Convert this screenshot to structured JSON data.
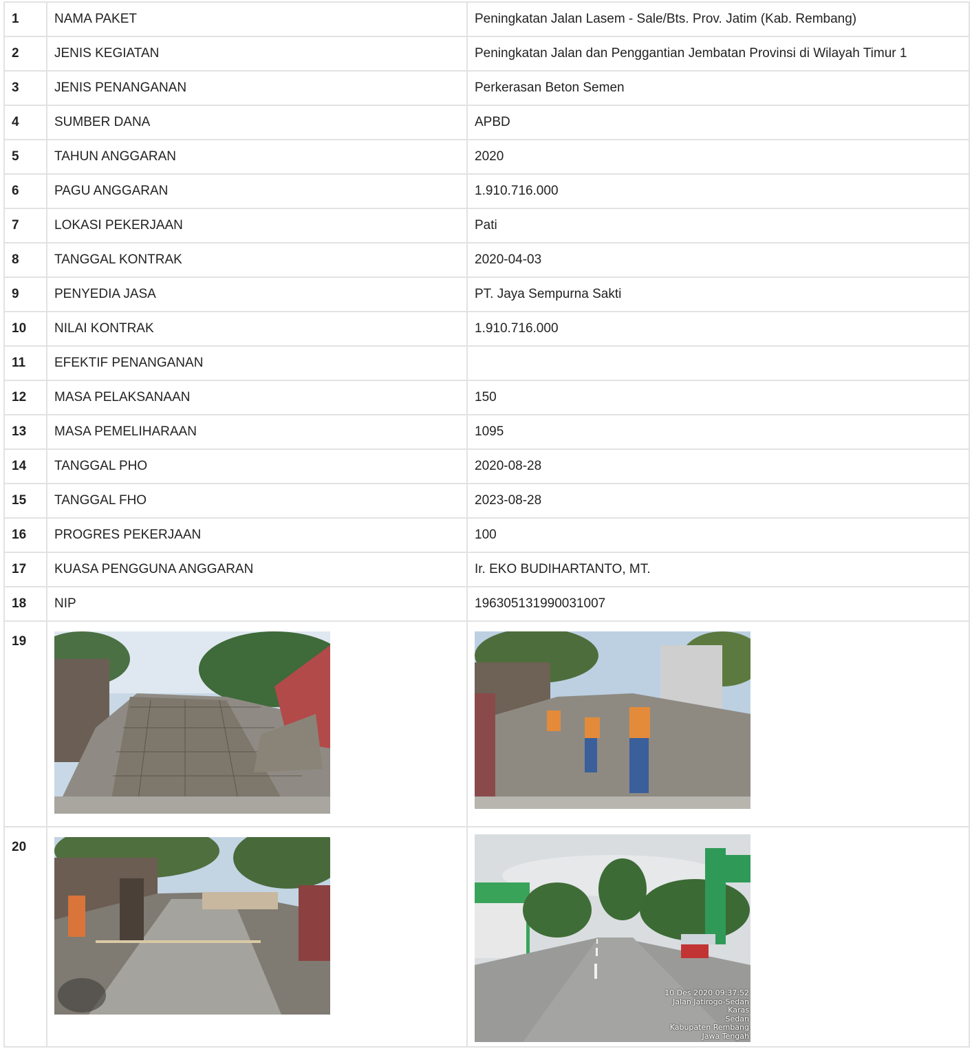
{
  "rows": [
    {
      "no": "1",
      "label": "NAMA PAKET",
      "value": "Peningkatan Jalan Lasem - Sale/Bts. Prov. Jatim (Kab. Rembang)"
    },
    {
      "no": "2",
      "label": "JENIS KEGIATAN",
      "value": "Peningkatan Jalan dan Penggantian Jembatan Provinsi di Wilayah Timur 1"
    },
    {
      "no": "3",
      "label": "JENIS PENANGANAN",
      "value": "Perkerasan Beton Semen"
    },
    {
      "no": "4",
      "label": "SUMBER DANA",
      "value": "APBD"
    },
    {
      "no": "5",
      "label": "TAHUN ANGGARAN",
      "value": "2020"
    },
    {
      "no": "6",
      "label": "PAGU ANGGARAN",
      "value": "1.910.716.000"
    },
    {
      "no": "7",
      "label": "LOKASI PEKERJAAN",
      "value": "Pati"
    },
    {
      "no": "8",
      "label": "TANGGAL KONTRAK",
      "value": "2020-04-03"
    },
    {
      "no": "9",
      "label": "PENYEDIA JASA",
      "value": "PT. Jaya Sempurna Sakti"
    },
    {
      "no": "10",
      "label": "NILAI KONTRAK",
      "value": "1.910.716.000"
    },
    {
      "no": "11",
      "label": "EFEKTIF PENANGANAN",
      "value": ""
    },
    {
      "no": "12",
      "label": "MASA PELAKSANAAN",
      "value": "150"
    },
    {
      "no": "13",
      "label": "MASA PEMELIHARAAN",
      "value": "1095"
    },
    {
      "no": "14",
      "label": "TANGGAL PHO",
      "value": "2020-08-28"
    },
    {
      "no": "15",
      "label": "TANGGAL FHO",
      "value": "2023-08-28"
    },
    {
      "no": "16",
      "label": "PROGRES PEKERJAAN",
      "value": "100"
    },
    {
      "no": "17",
      "label": "KUASA PENGGUNA ANGGARAN",
      "value": "Ir. EKO BUDIHARTANTO, MT."
    },
    {
      "no": "18",
      "label": "NIP",
      "value": "196305131990031007"
    }
  ],
  "photo_rows": [
    {
      "no": "19"
    },
    {
      "no": "20"
    }
  ],
  "stamp": {
    "line1": "10 Des 2020 09:37:52",
    "line2": "Jalan Jatirogo-Sedan",
    "line3": "Karas",
    "line4": "Sedan",
    "line5": "Kabupaten Rembang",
    "line6": "Jawa Tengah"
  }
}
